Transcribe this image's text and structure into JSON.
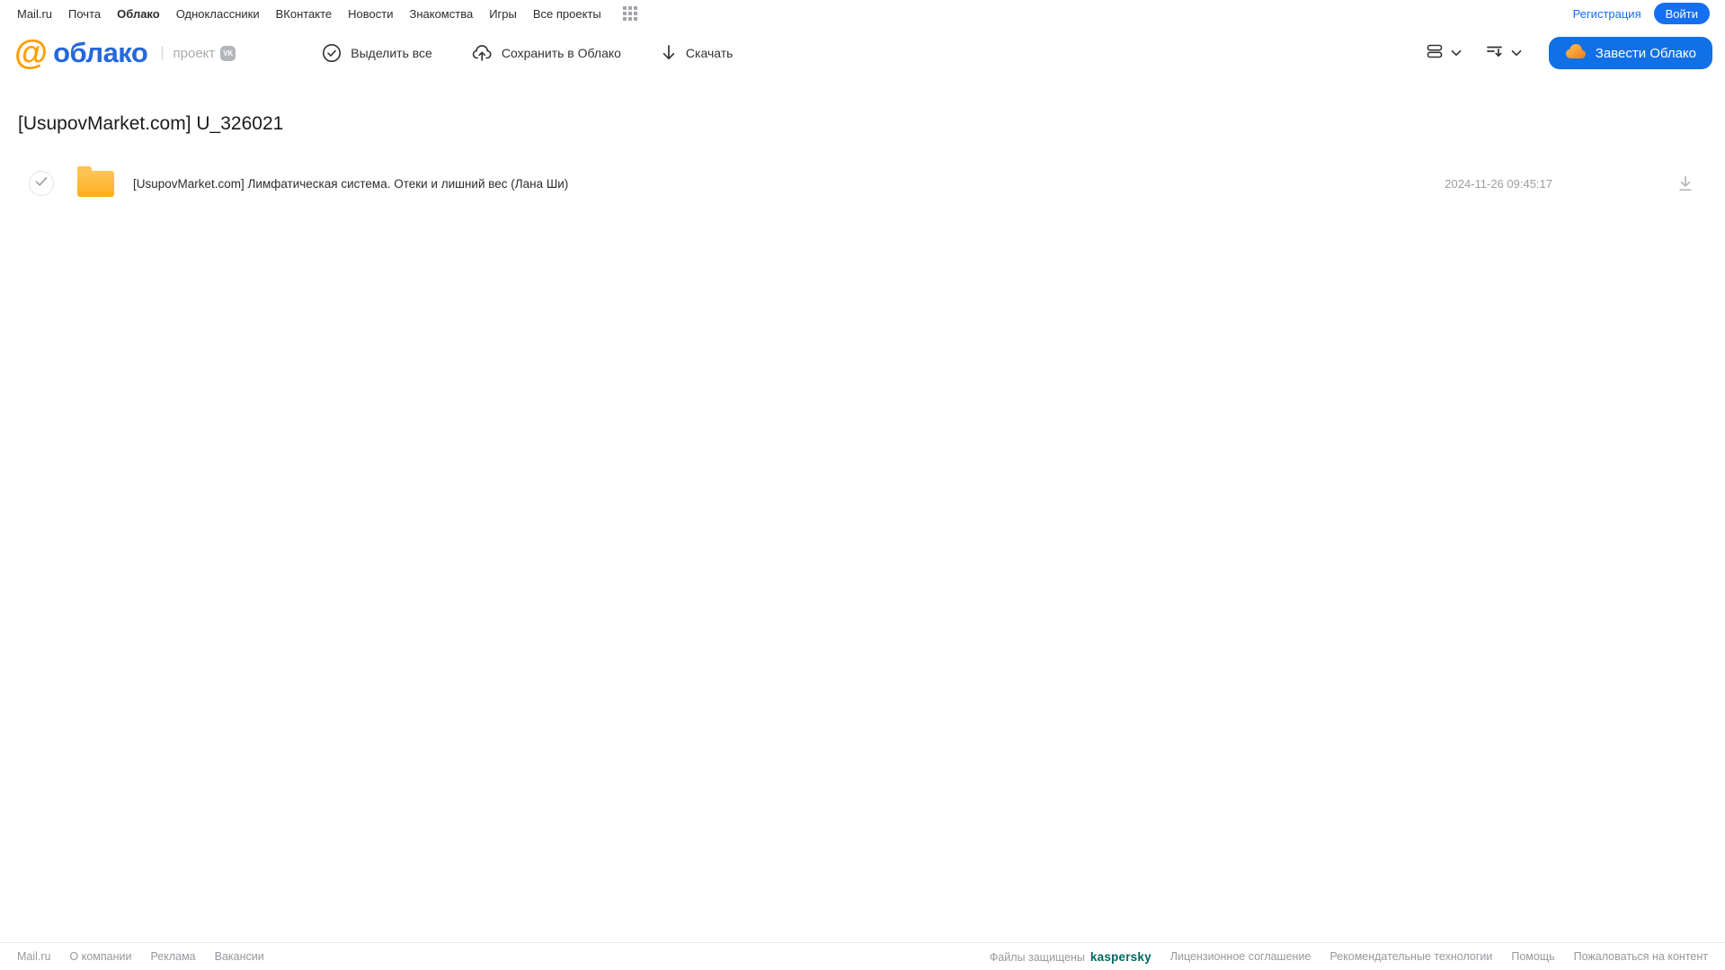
{
  "topbar": {
    "links": [
      {
        "label": "Mail.ru"
      },
      {
        "label": "Почта"
      },
      {
        "label": "Облако",
        "active": true
      },
      {
        "label": "Одноклассники"
      },
      {
        "label": "ВКонтакте"
      },
      {
        "label": "Новости"
      },
      {
        "label": "Знакомства"
      },
      {
        "label": "Игры"
      },
      {
        "label": "Все проекты"
      }
    ],
    "registration_label": "Регистрация",
    "login_label": "Войти"
  },
  "header": {
    "logo_at": "@",
    "logo_text": "облако",
    "project_label": "проект",
    "vk_badge": "VK",
    "toolbar": {
      "select_all_label": "Выделить все",
      "save_to_cloud_label": "Сохранить в Облако",
      "download_label": "Скачать"
    },
    "get_cloud_label": "Завести Облако"
  },
  "main": {
    "title": "[UsupovMarket.com] U_326021",
    "files": [
      {
        "type": "folder",
        "name": "[UsupovMarket.com] Лимфатическая система. Отеки и лишний вес (Лана Ши)",
        "date": "2024-11-26 09:45:17"
      }
    ]
  },
  "footer": {
    "left_links": [
      {
        "label": "Mail.ru"
      },
      {
        "label": "О компании"
      },
      {
        "label": "Реклама"
      },
      {
        "label": "Вакансии"
      }
    ],
    "protected_label": "Файлы защищены",
    "kaspersky_label": "kaspersky",
    "right_links": [
      {
        "label": "Лицензионное соглашение"
      },
      {
        "label": "Рекомендательные технологии"
      },
      {
        "label": "Помощь"
      },
      {
        "label": "Пожаловаться на контент"
      }
    ]
  },
  "icons": {
    "apps-grid-icon": "3x3 dot grid ▦",
    "select-all-icon": "circled check ✓",
    "save-to-cloud-icon": "cloud with up arrow ☁↑",
    "download-icon": "down arrow ↓",
    "view-mode-icon": "stacked list bars ☰",
    "sort-icon": "lines with down arrow ⇵",
    "chevron-down-icon": "⌄",
    "cloud-icon": "orange cloud ☁",
    "folder-icon": "yellow folder 📁",
    "check-circle-icon": "✓ in circle",
    "download-underline-icon": "⭳"
  },
  "colors": {
    "accent_blue": "#156ff2",
    "button_blue": "#1170e6",
    "logo_orange": "#ff9e00",
    "logo_blue": "#2668db",
    "folder_yellow": "#ffb82e",
    "kaspersky_teal": "#00695f",
    "muted_gray": "#9b9ea3"
  }
}
